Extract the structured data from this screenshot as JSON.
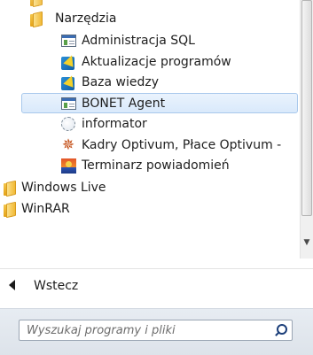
{
  "tree": {
    "items": [
      {
        "label": "",
        "icon": "folder-icon"
      },
      {
        "label": "Narzędzia",
        "icon": "folder-icon"
      },
      {
        "label": "Administracja SQL",
        "icon": "app-window-icon"
      },
      {
        "label": "Aktualizacje programów",
        "icon": "optivum-icon"
      },
      {
        "label": "Baza wiedzy",
        "icon": "optivum-icon"
      },
      {
        "label": "BONET Agent",
        "icon": "app-window-icon"
      },
      {
        "label": "informator",
        "icon": "globe-icon"
      },
      {
        "label": "Kadry Optivum, Płace Optivum -",
        "icon": "wheel-icon"
      },
      {
        "label": "Terminarz powiadomień",
        "icon": "calendar-icon"
      },
      {
        "label": "Windows Live",
        "icon": "folder-icon"
      },
      {
        "label": "WinRAR",
        "icon": "folder-icon"
      }
    ],
    "selected_item": "BONET Agent"
  },
  "nav": {
    "back_label": "Wstecz",
    "back_icon": "triangle-left-icon"
  },
  "search": {
    "placeholder": "Wyszukaj programy i pliki",
    "value": "",
    "icon": "magnifier-icon"
  },
  "scrollbar": {
    "down_arrow": "▼"
  },
  "colors": {
    "selection_bg": "#dbe9fb",
    "selection_border": "#a8c8ec",
    "bottom_panel": "#e2e8ef",
    "search_icon": "#1c3f7a"
  }
}
